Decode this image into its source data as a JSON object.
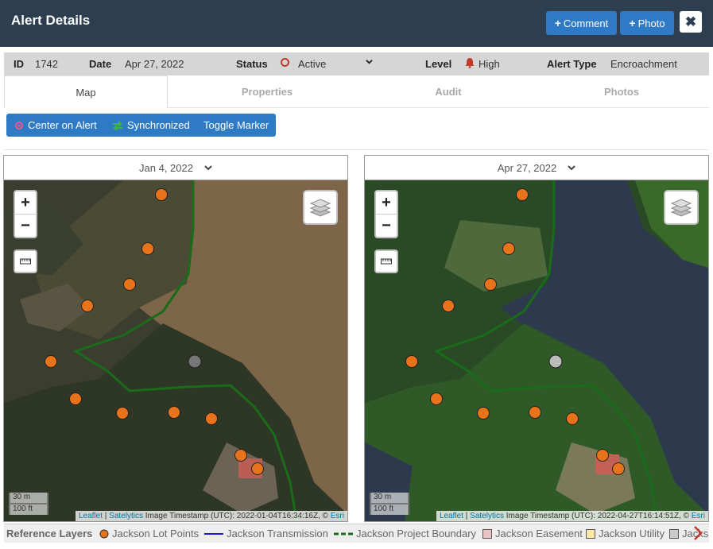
{
  "header": {
    "title": "Alert Details",
    "comment_label": "Comment",
    "photo_label": "Photo"
  },
  "info": {
    "id_label": "ID",
    "id_value": "1742",
    "date_label": "Date",
    "date_value": "Apr 27, 2022",
    "status_label": "Status",
    "status_value": "Active",
    "level_label": "Level",
    "level_value": "High",
    "type_label": "Alert Type",
    "type_value": "Encroachment"
  },
  "tabs": [
    "Map",
    "Properties",
    "Audit",
    "Photos"
  ],
  "toolbar": {
    "center": "Center on Alert",
    "sync": "Synchronized",
    "toggle": "Toggle Marker"
  },
  "left_map": {
    "date": "Jan 4, 2022",
    "scale_m": "30 m",
    "scale_ft": "100 ft",
    "attrib_leaflet": "Leaflet",
    "attrib_satelytics": "Satelytics",
    "attrib_text": "Image Timestamp (UTC): 2022-01-04T16:34:16Z, ©",
    "attrib_esri": "Esri"
  },
  "right_map": {
    "date": "Apr 27, 2022",
    "scale_m": "30 m",
    "scale_ft": "100 ft",
    "attrib_leaflet": "Leaflet",
    "attrib_satelytics": "Satelytics",
    "attrib_text": "Image Timestamp (UTC): 2022-04-27T16:14:51Z, ©",
    "attrib_esri": "Esri"
  },
  "legend": {
    "title": "Reference Layers",
    "items": [
      "Jackson Lot Points",
      "Jackson Transmission",
      "Jackson Project Boundary",
      "Jackson Easement",
      "Jackson Utility",
      "Jacks"
    ]
  },
  "colors": {
    "header_bg": "#2c3e50",
    "accent": "#2f7ac5",
    "lot_point": "#e8731a",
    "boundary": "#1a6b1a",
    "status": "#c0392b"
  },
  "icons": {
    "center": "crosshair-icon",
    "sync": "sync-arrows-icon",
    "layers": "layers-icon",
    "ruler": "ruler-icon",
    "bell": "bell-icon"
  }
}
